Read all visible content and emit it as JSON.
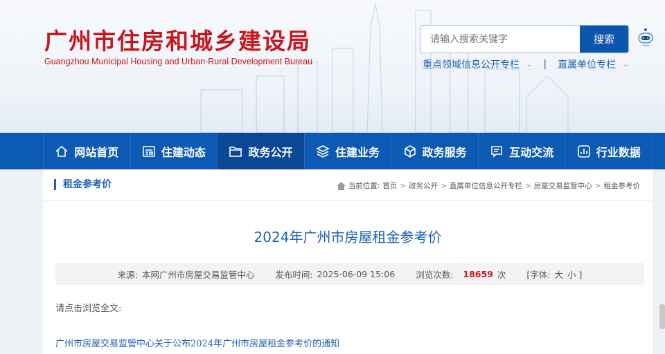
{
  "header": {
    "logo_cn": "广州市住房和城乡建设局",
    "logo_en": "Guangzhou Municipal Housing and Urban-Rural Development Bureau",
    "search_placeholder": "请输入搜索关键字",
    "search_button": "搜索",
    "links": [
      "重点领域信息公开专栏",
      "直属单位专栏"
    ]
  },
  "nav": {
    "items": [
      {
        "label": "网站首页",
        "icon": "home-icon"
      },
      {
        "label": "住建动态",
        "icon": "news-icon"
      },
      {
        "label": "政务公开",
        "icon": "folder-icon",
        "active": true
      },
      {
        "label": "住建业务",
        "icon": "layers-icon"
      },
      {
        "label": "政务服务",
        "icon": "cube-icon"
      },
      {
        "label": "互动交流",
        "icon": "chat-icon"
      },
      {
        "label": "行业数据",
        "icon": "chart-icon"
      }
    ]
  },
  "section": {
    "title": "租金参考价",
    "breadcrumb_label": "当前位置:",
    "breadcrumb": [
      "首页",
      "政务公开",
      "直属单位信息公开专栏",
      "房屋交易监管中心",
      "租金参考价"
    ]
  },
  "article": {
    "title": "2024年广州市房屋租金参考价",
    "source_label": "来源:",
    "source": "本网广州市房屋交易监管中心",
    "date_label": "发布时间:",
    "date": "2025-06-09 15:06",
    "views_label": "浏览次数:",
    "views": "18659",
    "views_unit": "次",
    "font_label": "[字体:",
    "font_large": "大",
    "font_small": "小 ]",
    "intro": "请点击浏览全文:",
    "link": "广州市房屋交易监管中心关于公布2024年广州市房屋租金参考价的通知"
  },
  "colors": {
    "brand_red": "#c8161d",
    "nav_blue": "#0d5ab4",
    "link_blue": "#1d5fb3"
  }
}
